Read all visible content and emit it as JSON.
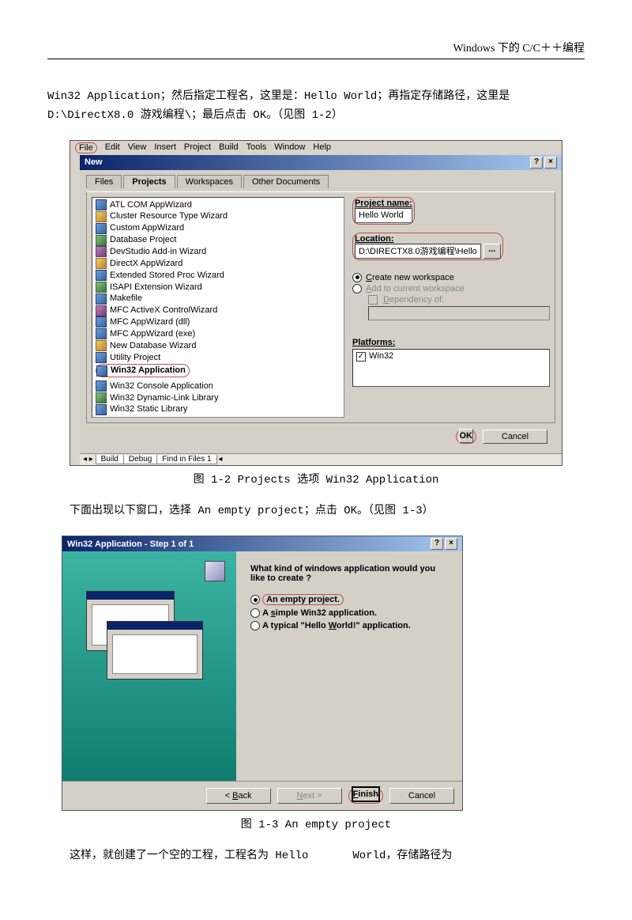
{
  "header": "Windows 下的 C/C＋＋编程",
  "para1": "Win32 Application；然后指定工程名，这里是：Hello World；再指定存储路径，这里是 D:\\DirectX8.0 游戏编程\\；最后点击 OK。（见图 1-2）",
  "caption1": "图 1-2 Projects 选项 Win32 Application",
  "para2": "下面出现以下窗口，选择 An empty project；点击 OK。（见图 1-3）",
  "caption2": "图 1-3 An empty project",
  "para3": "这样，就创建了一个空的工程，工程名为 Hello　　　　World，存储路径为",
  "menu": {
    "file": "File",
    "items": [
      "Edit",
      "View",
      "Insert",
      "Project",
      "Build",
      "Tools",
      "Window",
      "Help"
    ]
  },
  "newdlg": {
    "title": "New",
    "help": "?",
    "close": "×",
    "tabs": {
      "files": "Files",
      "projects": "Projects",
      "workspaces": "Workspaces",
      "other": "Other Documents"
    },
    "projects": [
      "ATL COM AppWizard",
      "Cluster Resource Type Wizard",
      "Custom AppWizard",
      "Database Project",
      "DevStudio Add-in Wizard",
      "DirectX AppWizard",
      "Extended Stored Proc Wizard",
      "ISAPI Extension Wizard",
      "Makefile",
      "MFC ActiveX ControlWizard",
      "MFC AppWizard (dll)",
      "MFC AppWizard (exe)",
      "New Database Wizard",
      "Utility Project",
      "Win32 Application",
      "Win32 Console Application",
      "Win32 Dynamic-Link Library",
      "Win32 Static Library"
    ],
    "pnameLabel": "Project name:",
    "pname": "Hello World",
    "locLabel": "Location:",
    "loc": "D:\\DIRECTX8.0游戏编程\\Hello",
    "browse": "...",
    "createNew": "Create new workspace",
    "addTo": "Add to current workspace",
    "depOf": "Dependency of:",
    "platformsLabel": "Platforms:",
    "platform": "Win32",
    "ok": "OK",
    "cancel": "Cancel",
    "buildTab": "Build",
    "debugTab": "Debug",
    "findTab": "Find in Files 1"
  },
  "wizard": {
    "title": "Win32 Application - Step 1 of 1",
    "help": "?",
    "close": "×",
    "question": "What kind of windows application would you like to create ?",
    "opt1": "An empty project.",
    "opt2_pre": "A ",
    "opt2_u": "s",
    "opt2_post": "imple Win32 application.",
    "opt3_pre": "A typical \"Hello ",
    "opt3_u": "W",
    "opt3_post": "orld!\"  application.",
    "back_lt": "<",
    "back_u": "B",
    "back_post": "ack",
    "next_u": "N",
    "next_post": "ext >",
    "finish_u": "F",
    "finish_post": "inish",
    "cancel": "Cancel"
  }
}
